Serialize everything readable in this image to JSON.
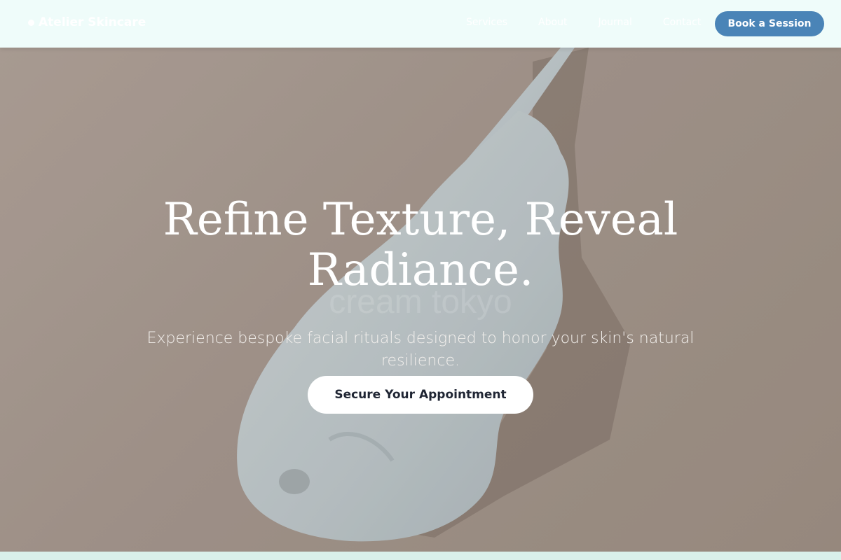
{
  "nav": {
    "brand": "Atelier Skincare",
    "links": [
      "Services",
      "About",
      "Journal",
      "Contact"
    ],
    "book_label": "Book a Session"
  },
  "hero": {
    "title_line1": "Refine Texture, Reveal",
    "title_line2": "Radiance.",
    "watermark": "cream tokyo",
    "subtitle": "Experience bespoke facial rituals designed to honor your skin's natural resilience.",
    "cta_label": "Secure Your Appointment"
  },
  "colors": {
    "nav_bg": "#effcfa",
    "accent": "#4a84b7",
    "cta_bg": "#ffffff",
    "cta_text": "#1f2533"
  }
}
